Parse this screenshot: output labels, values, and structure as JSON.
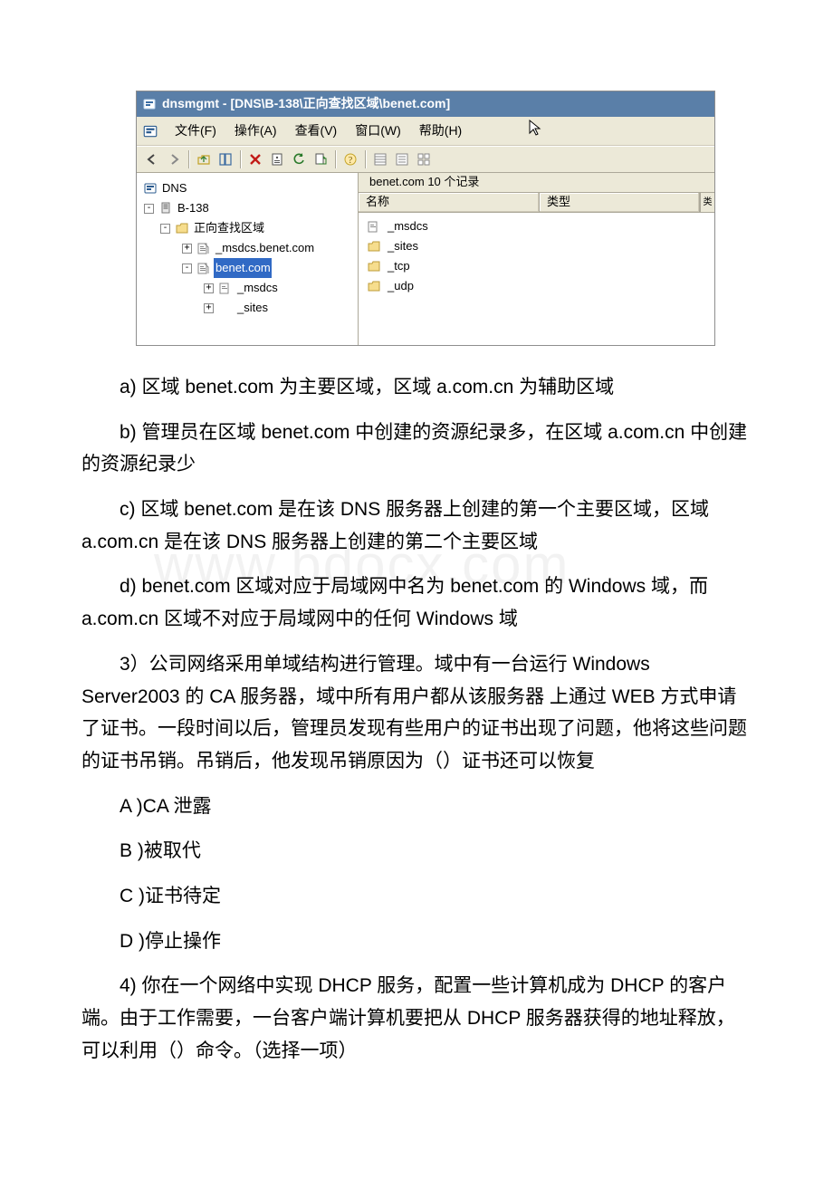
{
  "mmc": {
    "title": "dnsmgmt - [DNS\\B-138\\正向查找区域\\benet.com]",
    "menu": {
      "file": "文件(F)",
      "action": "操作(A)",
      "view": "查看(V)",
      "window": "窗口(W)",
      "help": "帮助(H)"
    },
    "tree": {
      "root": "DNS",
      "server": "B-138",
      "fwd": "正向查找区域",
      "zoneA": "_msdcs.benet.com",
      "zoneB": "benet.com",
      "sub1": "_msdcs",
      "sub2": "_sites"
    },
    "list": {
      "header": "benet.com   10 个记录",
      "col_name": "名称",
      "col_type": "类型",
      "scroll_glyph": "类",
      "items": [
        {
          "label": "_msdcs",
          "icon": "zone"
        },
        {
          "label": "_sites",
          "icon": "folder"
        },
        {
          "label": "_tcp",
          "icon": "folder"
        },
        {
          "label": "_udp",
          "icon": "folder"
        }
      ]
    }
  },
  "questions": {
    "q2_a": "a) 区域 benet.com 为主要区域，区域 a.com.cn 为辅助区域",
    "q2_b": "b) 管理员在区域 benet.com 中创建的资源纪录多，在区域 a.com.cn 中创建的资源纪录少",
    "q2_c": "c) 区域 benet.com 是在该 DNS 服务器上创建的第一个主要区域，区域 a.com.cn 是在该 DNS 服务器上创建的第二个主要区域",
    "q2_d": "d) benet.com 区域对应于局域网中名为 benet.com 的 Windows 域，而 a.com.cn 区域不对应于局域网中的任何 Windows 域",
    "q3": "3）公司网络采用单域结构进行管理。域中有一台运行 Windows Server2003 的 CA 服务器，域中所有用户都从该服务器 上通过 WEB 方式申请了证书。一段时间以后，管理员发现有些用户的证书出现了问题，他将这些问题的证书吊销。吊销后，他发现吊销原因为（）证书还可以恢复",
    "q3_a": "A )CA 泄露",
    "q3_b": "B )被取代",
    "q3_c": "C )证书待定",
    "q3_d": "D )停止操作",
    "q4": "4) 你在一个网络中实现 DHCP 服务，配置一些计算机成为 DHCP 的客户端。由于工作需要，一台客户端计算机要把从 DHCP 服务器获得的地址释放，可以利用（）命令。（选择一项）"
  },
  "watermark": "www.bdocx.com"
}
